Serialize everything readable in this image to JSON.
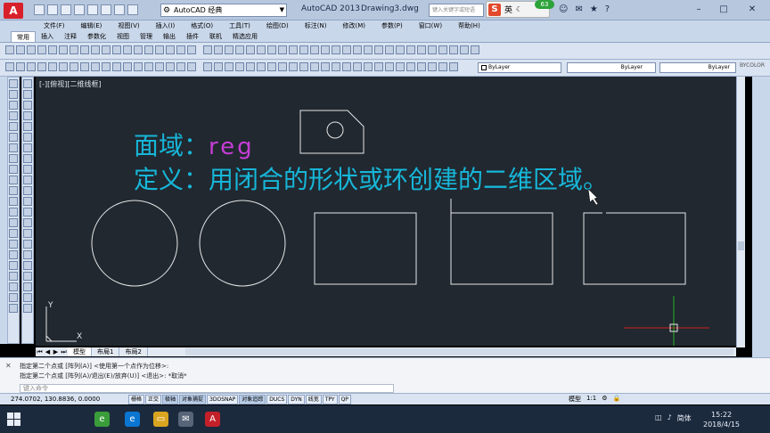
{
  "titlebar": {
    "app_letter": "A",
    "workspace": "AutoCAD 经典",
    "app_name": "AutoCAD 2013",
    "doc_name": "Drawing3.dwg",
    "search_placeholder": "键入关键字或短语",
    "ime_label": "英",
    "ime_badge": "63",
    "help": "?",
    "minimize": "–",
    "maximize": "□",
    "close": "✕"
  },
  "menubar": [
    "文件(F)",
    "编辑(E)",
    "视图(V)",
    "插入(I)",
    "格式(O)",
    "工具(T)",
    "绘图(D)",
    "标注(N)",
    "修改(M)",
    "参数(P)",
    "窗口(W)",
    "帮助(H)"
  ],
  "ribbon_tabs": [
    {
      "label": "常用",
      "active": true
    },
    {
      "label": "插入"
    },
    {
      "label": "注释"
    },
    {
      "label": "参数化"
    },
    {
      "label": "视图"
    },
    {
      "label": "管理"
    },
    {
      "label": "输出"
    },
    {
      "label": "插件"
    },
    {
      "label": "联机"
    },
    {
      "label": "精选应用"
    }
  ],
  "properties": {
    "layer": "ByLayer",
    "linetype": "ByLayer",
    "lineweight": "ByLayer",
    "plotstyle": "BYCOLOR"
  },
  "viewport_label": "[-][俯视][二维线框]",
  "lesson": {
    "line1_prefix": "面域：",
    "line1_cmd": "reg",
    "line2": "定义：用闭合的形状或环创建的二维区域。"
  },
  "layout_tabs": {
    "model": "模型",
    "layout1": "布局1",
    "layout2": "布局2"
  },
  "command": {
    "history": [
      "指定第二个点或 [阵列(A)] <使用第一个点作为位移>:",
      "指定第二个点或 [阵列(A)/退出(E)/放弃(U)] <退出>: *取消*"
    ],
    "placeholder": "键入命令"
  },
  "status": {
    "coords": "274.0702, 130.8836, 0.0000",
    "toggles": [
      {
        "label": "栅格",
        "on": false
      },
      {
        "label": "正交",
        "on": false
      },
      {
        "label": "极轴",
        "on": true
      },
      {
        "label": "对象捕捉",
        "on": true
      },
      {
        "label": "3DOSNAP",
        "on": false
      },
      {
        "label": "对象追踪",
        "on": true
      },
      {
        "label": "DUCS",
        "on": false
      },
      {
        "label": "DYN",
        "on": false
      },
      {
        "label": "线宽",
        "on": false
      },
      {
        "label": "TPY",
        "on": false
      },
      {
        "label": "QP",
        "on": false
      }
    ],
    "model": "模型",
    "annotation_scale": "1:1"
  },
  "taskbar": {
    "ime": "简体",
    "time": "15:22",
    "date": "2018/4/15"
  },
  "colors": {
    "canvas_bg": "#212830",
    "lesson_text": "#17b6d8",
    "command_text": "#c63dd6",
    "geometry": "#e6e6e6",
    "ucs_x_axis": "#d11f1f",
    "ucs_y_axis": "#22b522"
  }
}
